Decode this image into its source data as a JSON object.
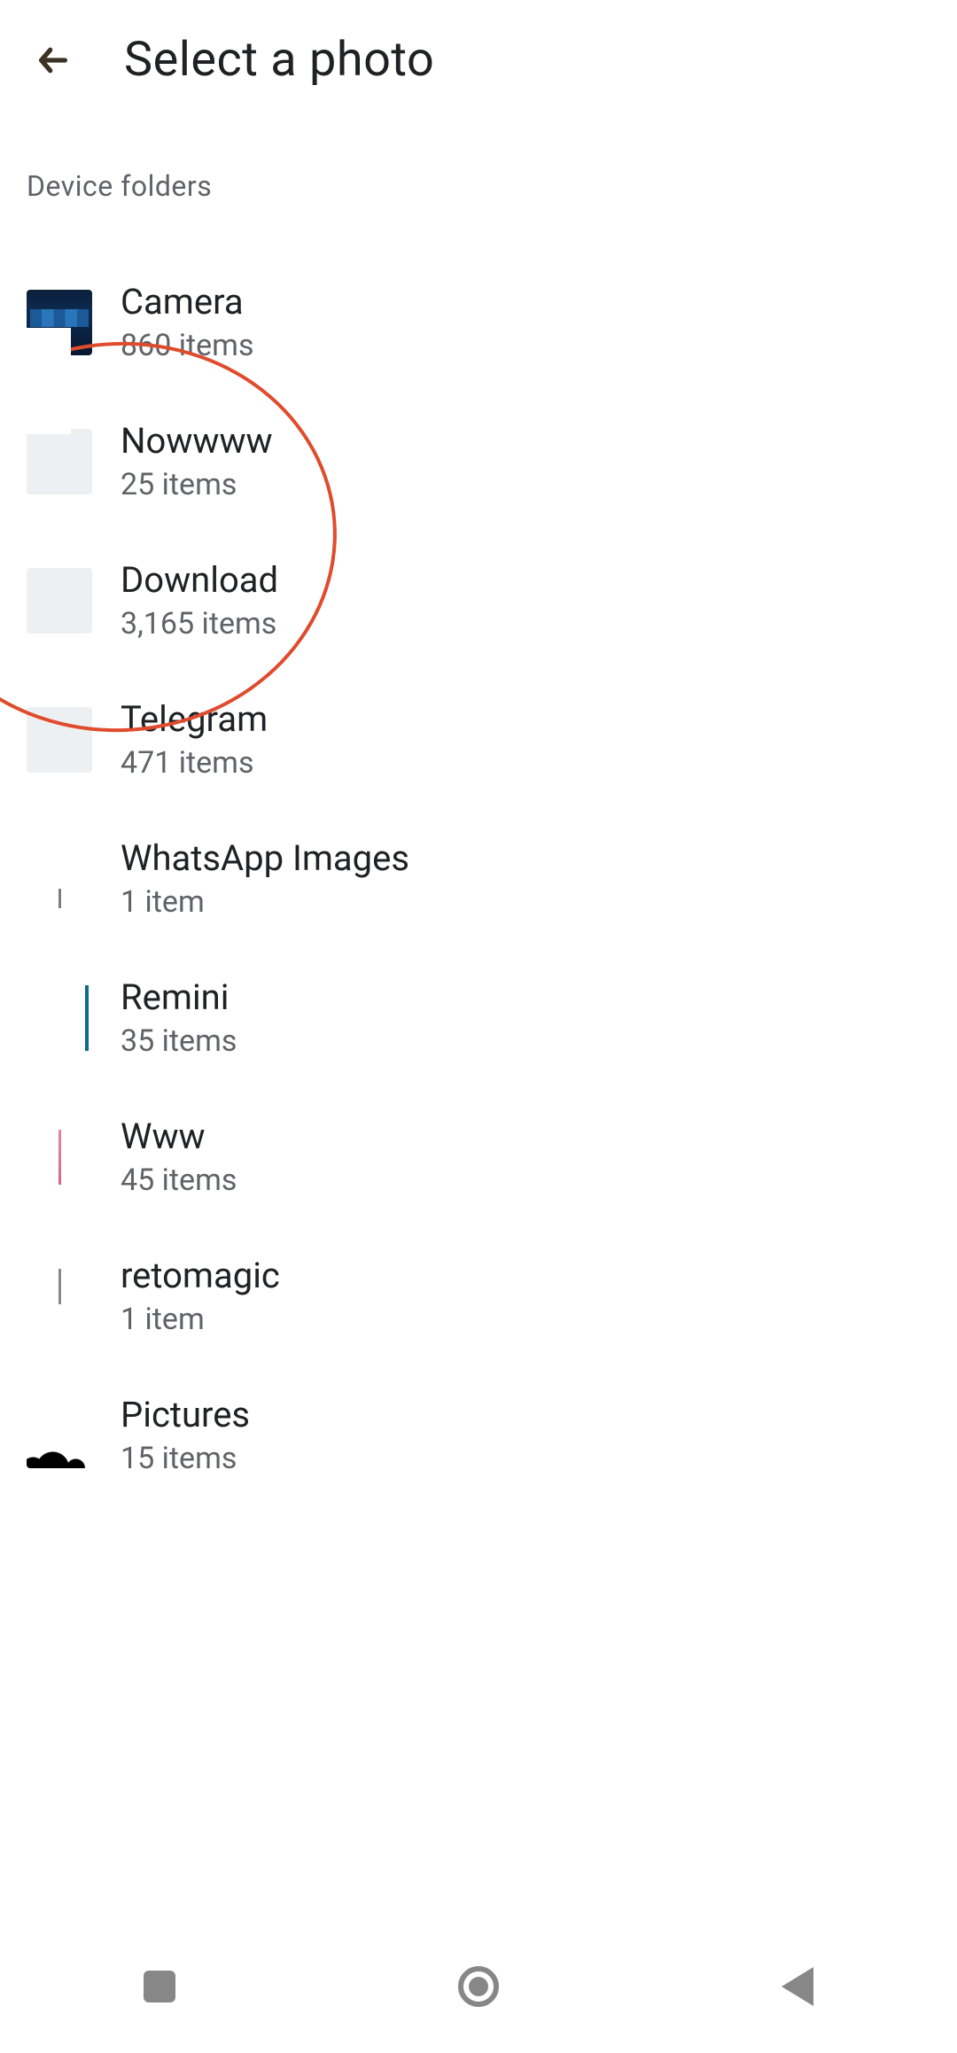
{
  "header": {
    "title": "Select a photo"
  },
  "section_label": "Device folders",
  "folders": [
    {
      "name": "Camera",
      "count": "860 items",
      "thumb": "camera"
    },
    {
      "name": "Nowwww",
      "count": "25 items",
      "thumb": "blank"
    },
    {
      "name": "Download",
      "count": "3,165 items",
      "thumb": "blank"
    },
    {
      "name": "Telegram",
      "count": "471 items",
      "thumb": "blank"
    },
    {
      "name": "WhatsApp Images",
      "count": "1 item",
      "thumb": "whatsapp"
    },
    {
      "name": "Remini",
      "count": "35 items",
      "thumb": "remini"
    },
    {
      "name": "Www",
      "count": "45 items",
      "thumb": "www"
    },
    {
      "name": "retomagic",
      "count": "1 item",
      "thumb": "retomagic"
    },
    {
      "name": "Pictures",
      "count": "15 items",
      "thumb": "pictures"
    }
  ],
  "annotation": {
    "color": "#e04b2d"
  }
}
